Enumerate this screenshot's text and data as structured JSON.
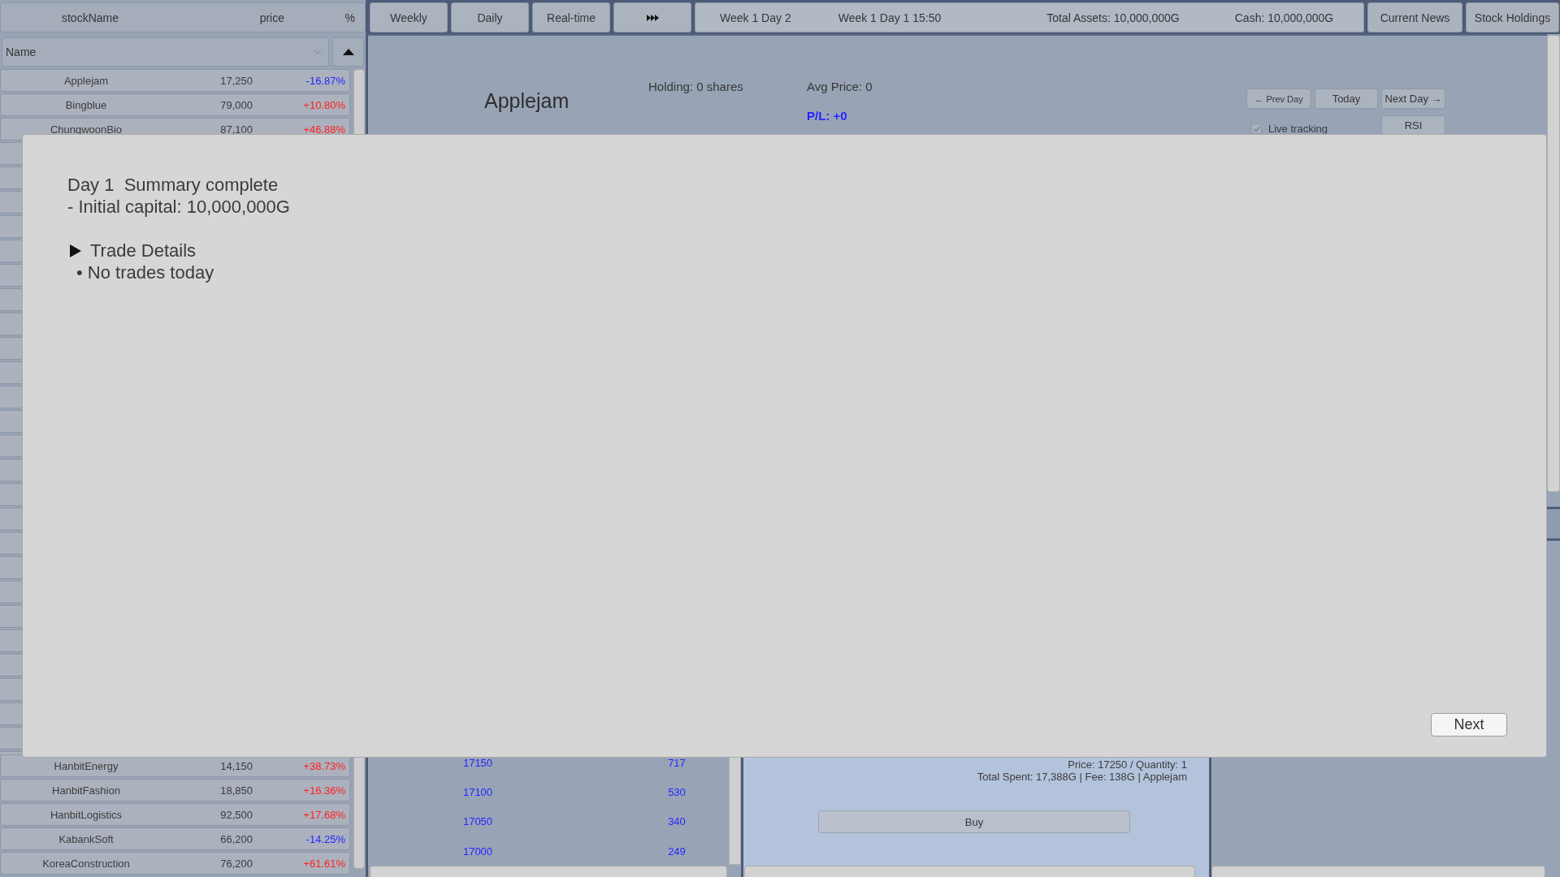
{
  "stock_list": {
    "columns": [
      "stockName",
      "price",
      "%"
    ],
    "sort_field": "Name",
    "rows_top": [
      {
        "name": "Applejam",
        "price": "17,250",
        "change": "-16.87%",
        "color": "#2626ff"
      },
      {
        "name": "Bingblue",
        "price": "79,000",
        "change": "+10.80%",
        "color": "#ff2020"
      },
      {
        "name": "ChungwoonBio",
        "price": "87,100",
        "change": "+46.88%",
        "color": "#ff2020"
      }
    ],
    "rows_bottom": [
      {
        "name": "HanbitEnergy",
        "price": "14,150",
        "change": "+38.73%",
        "color": "#ff2020"
      },
      {
        "name": "HanbitFashion",
        "price": "18,850",
        "change": "+16.36%",
        "color": "#ff2020"
      },
      {
        "name": "HanbitLogistics",
        "price": "92,500",
        "change": "+17.68%",
        "color": "#ff2020"
      },
      {
        "name": "KabankSoft",
        "price": "66,200",
        "change": "-14.25%",
        "color": "#2626ff"
      },
      {
        "name": "KoreaConstruction",
        "price": "76,200",
        "change": "+61.61%",
        "color": "#ff2020"
      }
    ]
  },
  "view_tabs": [
    "Weekly",
    "Daily",
    "Real-time"
  ],
  "info_bar": {
    "current_day": "Week 1 Day 2",
    "current_time": "Week 1 Day 1 15:50",
    "total_assets": "Total Assets: 10,000,000G",
    "cash": "Cash: 10,000,000G"
  },
  "top_buttons": [
    "Current News",
    "Stock Holdings"
  ],
  "stock_detail": {
    "name": "Applejam",
    "holding": "Holding: 0 shares",
    "avg_price": "Avg Price: 0",
    "profit_loss": "P/L: +0",
    "day_buttons": [
      "← Prev Day",
      "Today",
      "Next Day →"
    ],
    "live_tracking": {
      "label": "Live tracking",
      "checked": true
    },
    "indicator_button": "RSI"
  },
  "order_book": [
    {
      "price": "17150",
      "quantity": "717"
    },
    {
      "price": "17100",
      "quantity": "530"
    },
    {
      "price": "17050",
      "quantity": "340"
    },
    {
      "price": "17000",
      "quantity": "249"
    }
  ],
  "trade_panel": {
    "lines": [
      "Price: 17250 / Quantity: 1",
      "Total Spent: 17,388G | Fee: 138G | Applejam"
    ],
    "button": "Buy"
  },
  "dialog": {
    "lines": [
      "Day 1  Summary complete",
      "- Initial capital: 10,000,000G"
    ],
    "section": {
      "title": "Trade Details",
      "items": [
        "• No trades today"
      ]
    },
    "button": "Next"
  }
}
